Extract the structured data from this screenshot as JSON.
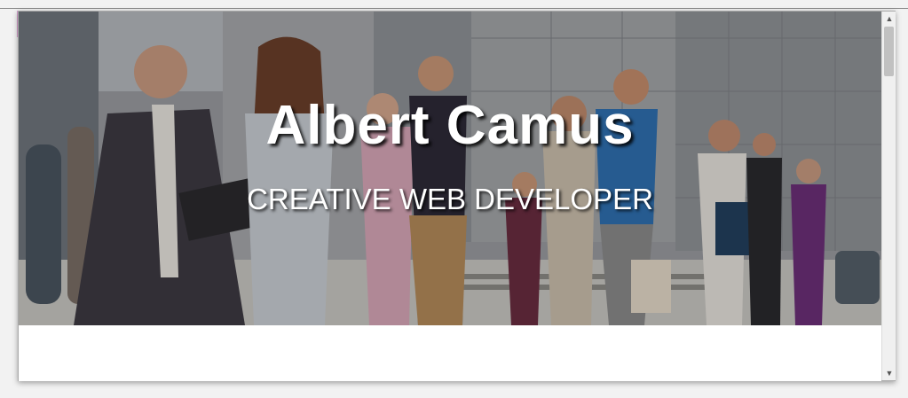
{
  "hero": {
    "title": "Albert Camus",
    "subtitle": "CREATIVE WEB DEVELOPER"
  },
  "scrollbar": {
    "up_icon": "triangle-up-icon",
    "down_icon": "triangle-down-icon",
    "up_glyph": "▲",
    "down_glyph": "▼",
    "position_fraction": 0.0
  },
  "colors": {
    "title_text": "#ffffff",
    "page_background": "#ffffff",
    "scroll_track": "#f0f0f0",
    "scroll_thumb": "#c1c1c1"
  }
}
